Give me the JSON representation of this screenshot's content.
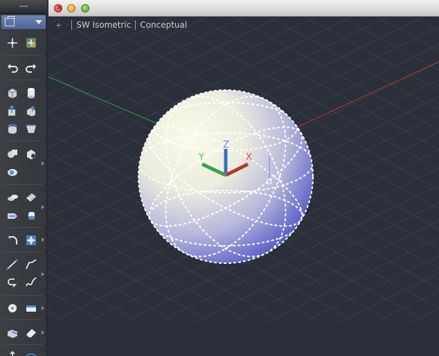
{
  "window": {
    "buttons": [
      "close",
      "minimize",
      "maximize"
    ]
  },
  "viewport": {
    "controls_label": "+",
    "view_label": "SW Isometric",
    "visual_style_label": "Conceptual",
    "axis_labels": {
      "x": "X",
      "y": "Y",
      "z": "Z"
    },
    "colors": {
      "background": "#2a2f3a",
      "grid": "#3a3f4b",
      "x_axis": "#c0392b",
      "y_axis": "#3aa04a",
      "z_axis": "#3b6fb8",
      "sphere_light": "#fafae6",
      "sphere_dark": "#4a4fc8"
    }
  },
  "palette": {
    "header_icon": "view-cube-icon",
    "tools": [
      "point-icon",
      "snap-icon",
      "undo-icon",
      "redo-icon",
      "box-icon",
      "cylinder-icon",
      "extrude-icon",
      "presspull-icon",
      "revolve-icon",
      "loft-icon",
      "union-icon",
      "subtract-icon",
      "intersect-icon",
      "mesh-icon",
      "mesh-edit-icon",
      "move-icon",
      "smooth-icon",
      "fillet-icon",
      "gizmo-icon",
      "line-icon",
      "polyline-icon",
      "arc-icon",
      "spline-icon",
      "circle-icon",
      "rectangle-icon",
      "solid-edit-icon",
      "eraser-icon"
    ]
  }
}
